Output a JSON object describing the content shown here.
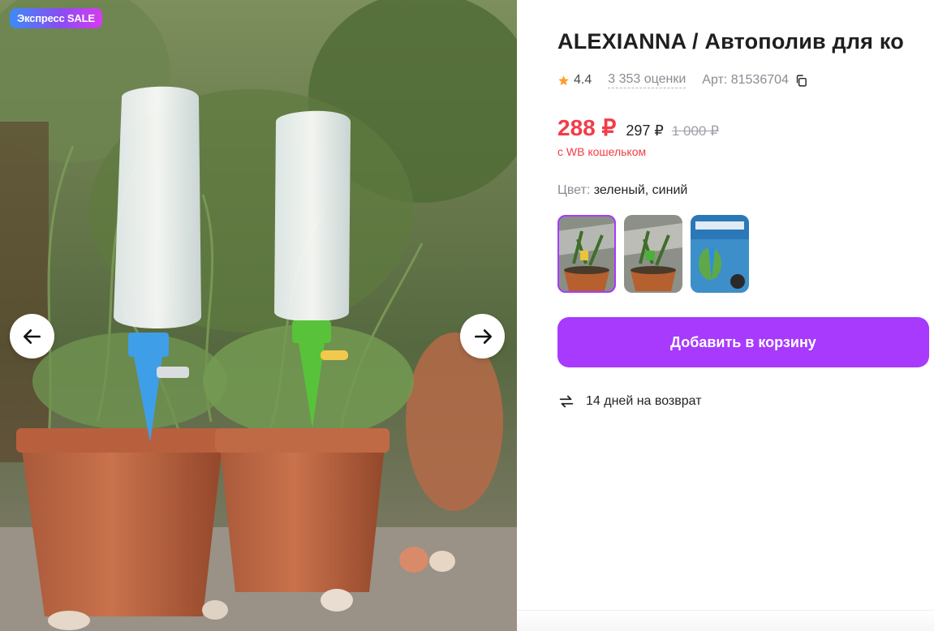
{
  "gallery": {
    "badge": "Экспресс SALE",
    "prev_icon": "arrow-left-icon",
    "next_icon": "arrow-right-icon"
  },
  "product": {
    "title": "ALEXIANNA / Автополив для ко",
    "rating": "4.4",
    "reviews": "3 353 оценки",
    "article": "Арт: 81536704",
    "price_current": "288 ₽",
    "price_base": "297 ₽",
    "price_old": "1 000 ₽",
    "wallet_note": "с WB кошельком",
    "color_label": "Цвет:",
    "color_value": "зеленый, синий",
    "variants": [
      {
        "name": "variant-1",
        "selected": true
      },
      {
        "name": "variant-2",
        "selected": false
      },
      {
        "name": "variant-3",
        "selected": false
      }
    ],
    "add_to_cart": "Добавить в корзину",
    "returns": "14 дней на возврат"
  },
  "colors": {
    "accent": "#a73afd",
    "price": "#f23c48",
    "star": "#ff9e2c",
    "muted": "#8b8b94"
  }
}
